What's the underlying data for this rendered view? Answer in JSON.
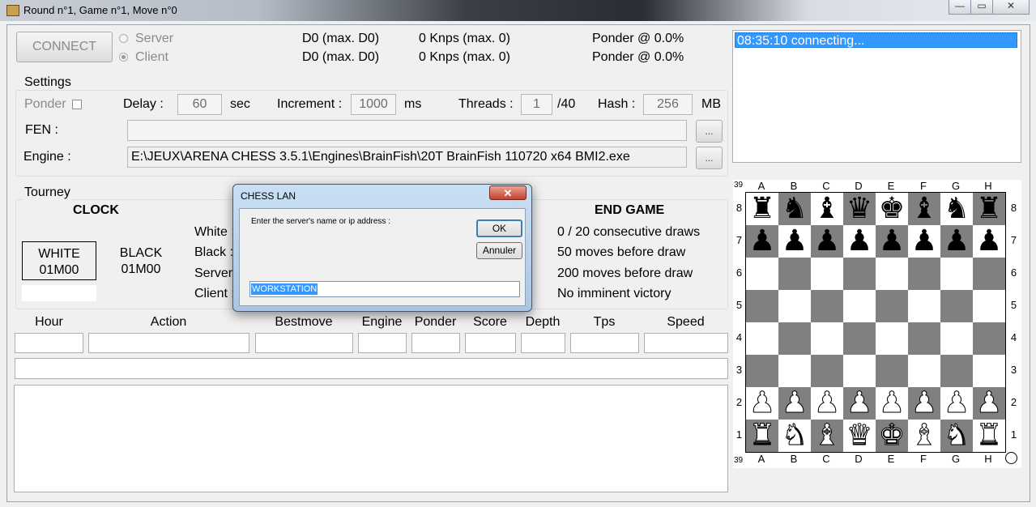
{
  "window": {
    "title": "Round n°1, Game n°1, Move n°0"
  },
  "connect": {
    "button_label": "CONNECT",
    "server_label": "Server",
    "client_label": "Client"
  },
  "status": {
    "depth1": "D0 (max. D0)",
    "depth2": "D0 (max. D0)",
    "knps1": "0 Knps (max. 0)",
    "knps2": "0 Knps (max. 0)",
    "ponder1": "Ponder @ 0.0%",
    "ponder2": "Ponder @ 0.0%"
  },
  "log": {
    "lines": [
      "08:35:10 connecting..."
    ]
  },
  "settings": {
    "title": "Settings",
    "ponder_label": "Ponder",
    "delay_label": "Delay :",
    "delay_value": "60",
    "delay_unit": "sec",
    "increment_label": "Increment :",
    "increment_value": "1000",
    "increment_unit": "ms",
    "threads_label": "Threads :",
    "threads_value": "1",
    "threads_max": "/40",
    "hash_label": "Hash :",
    "hash_value": "256",
    "hash_unit": "MB",
    "fen_label": "FEN :",
    "fen_value": "",
    "fen_browse": "...",
    "engine_label": "Engine :",
    "engine_value": "E:\\JEUX\\ARENA CHESS 3.5.1\\Engines\\BrainFish\\20T BrainFish 110720 x64 BMI2.exe",
    "engine_browse": "..."
  },
  "tourney": {
    "title": "Tourney",
    "clock_title": "CLOCK",
    "white_label": "WHITE",
    "white_time": "01M00",
    "black_label": "BLACK",
    "black_time": "01M00",
    "players": [
      "White :",
      "Black :",
      "Server",
      "Client :"
    ],
    "endgame_title": "END GAME",
    "endgame_lines": [
      "0 / 20 consecutive draws",
      "50 moves before draw",
      "200 moves before draw",
      "No imminent victory"
    ]
  },
  "table": {
    "headers": [
      "Hour",
      "Action",
      "Bestmove",
      "Engine",
      "Ponder",
      "Score",
      "Depth",
      "Tps",
      "Speed"
    ]
  },
  "board": {
    "files": [
      "A",
      "B",
      "C",
      "D",
      "E",
      "F",
      "G",
      "H"
    ],
    "ranks": [
      "8",
      "7",
      "6",
      "5",
      "4",
      "3",
      "2",
      "1"
    ],
    "corner_top": "39",
    "corner_bottom": "39",
    "light_color": "#ffffff",
    "dark_color": "#808080",
    "rows": [
      "rnbqkbnr",
      "pppppppp",
      "........",
      "........",
      "........",
      "........",
      "PPPPPPPP",
      "RNBQKBNR"
    ]
  },
  "dialog": {
    "title": "CHESS LAN",
    "close_label": "✕",
    "prompt": "Enter the server's name or ip address :",
    "ok_label": "OK",
    "cancel_label": "Annuler",
    "input_value": "WORKSTATION"
  }
}
